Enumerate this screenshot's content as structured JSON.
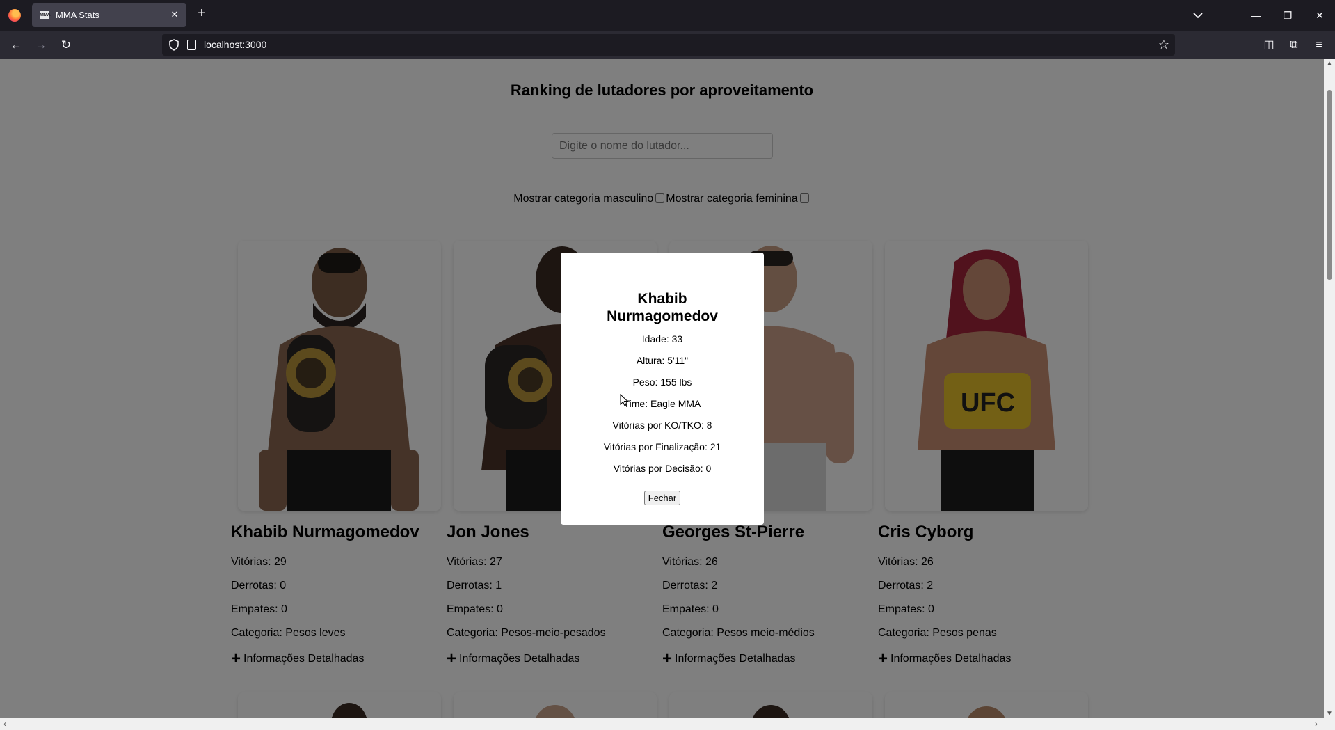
{
  "browser": {
    "tab_title": "MMA Stats",
    "tab_favicon_text": "MMA",
    "url": "localhost:3000"
  },
  "page": {
    "title": "Ranking de lutadores por aproveitamento",
    "search_placeholder": "Digite o nome do lutador...",
    "filter_male_label": "Mostrar categoria masculino",
    "filter_female_label": "Mostrar categoria feminina"
  },
  "fighters": [
    {
      "name": "Khabib Nurmagomedov",
      "wins": "Vitórias: 29",
      "losses": "Derrotas: 0",
      "draws": "Empates: 0",
      "category": "Categoria: Pesos leves",
      "details": "Informações Detalhadas"
    },
    {
      "name": "Jon Jones",
      "wins": "Vitórias: 27",
      "losses": "Derrotas: 1",
      "draws": "Empates: 0",
      "category": "Categoria: Pesos-meio-pesados",
      "details": "Informações Detalhadas"
    },
    {
      "name": "Georges St-Pierre",
      "wins": "Vitórias: 26",
      "losses": "Derrotas: 2",
      "draws": "Empates: 0",
      "category": "Categoria: Pesos meio-médios",
      "details": "Informações Detalhadas"
    },
    {
      "name": "Cris Cyborg",
      "wins": "Vitórias: 26",
      "losses": "Derrotas: 2",
      "draws": "Empates: 0",
      "category": "Categoria: Pesos penas",
      "details": "Informações Detalhadas"
    }
  ],
  "modal": {
    "name": "Khabib Nurmagomedov",
    "age": "Idade: 33",
    "height": "Altura: 5'11\"",
    "weight": "Peso: 155 lbs",
    "team": "Time: Eagle MMA",
    "ko_wins": "Vitórias por KO/TKO: 8",
    "sub_wins": "Vitórias por Finalização: 21",
    "dec_wins": "Vitórias por Decisão: 0",
    "close_label": "Fechar"
  },
  "colors": {
    "overlay": "#000000",
    "belt_gold": "#b8953a",
    "ufc_yellow": "#e6c12a"
  }
}
